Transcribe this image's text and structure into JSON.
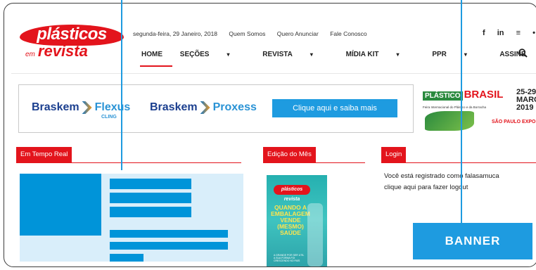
{
  "site": {
    "logo_top": "plásticos",
    "logo_em": "em",
    "logo_bottom": "revista"
  },
  "topbar": {
    "date": "segunda-feira, 29 Janeiro, 2018",
    "links": [
      "Quem Somos",
      "Quero Anunciar",
      "Fale Conosco"
    ]
  },
  "social": [
    "f",
    "in",
    "உ",
    "த"
  ],
  "nav": {
    "items": [
      {
        "label": "HOME"
      },
      {
        "label": "SEÇÕES"
      },
      {
        "label": "REVISTA"
      },
      {
        "label": "MÍDIA KIT"
      },
      {
        "label": "PPR"
      },
      {
        "label": "ASSINE"
      }
    ],
    "caret": "▾",
    "search_glyph": "🔍"
  },
  "ad": {
    "brand1": "Braskem",
    "product1": "Flexus",
    "product1_sub": "CLING",
    "brand2": "Braskem",
    "product2": "Proxess",
    "cta": "Clique aqui e saiba mais"
  },
  "expo": {
    "plast": "PLÁSTICO",
    "brasil": "BRASIL",
    "date_line1": "25-29",
    "date_line2": "MARÇO",
    "date_line3": "2019",
    "subtitle": "Feira Internacional do Plástico e da Borracha",
    "venue": "SÃO PAULO EXPO"
  },
  "sections": {
    "real_time": "Em Tempo Real",
    "edition": "Edição do Mês",
    "login": "Login"
  },
  "magazine": {
    "logo": "plásticos revista",
    "headline": "QUANDO A EMBALAGEM VENDE (MESMO) SAÚDE",
    "small": "A GRANDE POR SER UTIL A SUA FORMA FOI CRESCENDO NO PAÍS"
  },
  "login": {
    "line1": "Você está registrado como falasamuca",
    "line2": "clique aqui para fazer logout"
  },
  "callout": {
    "label": "BANNER"
  },
  "colors": {
    "brand_red": "#e3141c",
    "accent_blue": "#1e9be0",
    "placeholder_blue": "#0094d9",
    "placeholder_bg": "#d9eefa"
  }
}
